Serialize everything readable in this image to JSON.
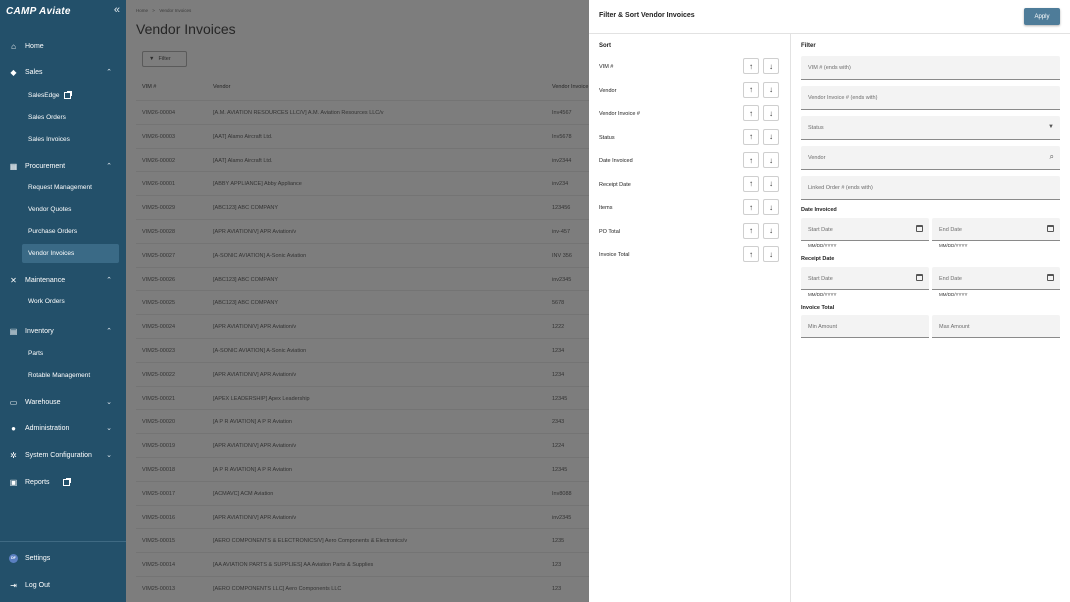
{
  "sidebar": {
    "logo": "CAMP Aviate",
    "collapse_icon": "double-chevron-left",
    "items": [
      {
        "label": "Home",
        "icon": "home-icon"
      },
      {
        "label": "Sales",
        "icon": "tag-icon",
        "expanded": true
      },
      {
        "label": "SalesEdge",
        "sub": true,
        "external": true
      },
      {
        "label": "Sales Orders",
        "sub": true
      },
      {
        "label": "Sales Invoices",
        "sub": true
      },
      {
        "label": "Procurement",
        "icon": "cart-icon",
        "expanded": true
      },
      {
        "label": "Request Management",
        "sub": true
      },
      {
        "label": "Vendor Quotes",
        "sub": true
      },
      {
        "label": "Purchase Orders",
        "sub": true
      },
      {
        "label": "Vendor Invoices",
        "sub": true,
        "active": true
      },
      {
        "label": "Maintenance",
        "icon": "wrench-icon",
        "expanded": true
      },
      {
        "label": "Work Orders",
        "sub": true
      },
      {
        "label": "Inventory",
        "icon": "inventory-icon",
        "expanded": true
      },
      {
        "label": "Parts",
        "sub": true
      },
      {
        "label": "Rotable Management",
        "sub": true
      },
      {
        "label": "Warehouse",
        "icon": "warehouse-icon"
      },
      {
        "label": "Administration",
        "icon": "people-icon"
      },
      {
        "label": "System Configuration",
        "icon": "gear-icon"
      },
      {
        "label": "Reports",
        "icon": "report-icon",
        "external": true
      }
    ],
    "settings_label": "Settings",
    "avatar_initials": "DF",
    "logout_label": "Log Out"
  },
  "main": {
    "breadcrumb": [
      "Home",
      ">",
      "Vendor Invoices"
    ],
    "title": "Vendor Invoices",
    "filter_label": "Filter",
    "columns": [
      "VIM #",
      "Vendor",
      "Vendor Invoice"
    ],
    "rows": [
      [
        "VIM26-00004",
        "[A.M. AVIATION RESOURCES LLC/V] A.M. Aviation Resources LLC/v",
        "Inv4567"
      ],
      [
        "VIM26-00003",
        "[AAT] Alamo Aircraft Ltd.",
        "Inv5678"
      ],
      [
        "VIM26-00002",
        "[AAT] Alamo Aircraft Ltd.",
        "inv2344"
      ],
      [
        "VIM26-00001",
        "[ABBY APPLIANCE] Abby Appliance",
        "inv234"
      ],
      [
        "VIM25-00029",
        "[ABC123] ABC COMPANY",
        "123456"
      ],
      [
        "VIM25-00028",
        "[APR AVIATION/V] APR Aviation/v",
        "inv-457"
      ],
      [
        "VIM25-00027",
        "[A-SONIC AVIATION] A-Sonic Aviation",
        "INV 356"
      ],
      [
        "VIM25-00026",
        "[ABC123] ABC COMPANY",
        "inv2345"
      ],
      [
        "VIM25-00025",
        "[ABC123] ABC COMPANY",
        "5678"
      ],
      [
        "VIM25-00024",
        "[APR AVIATION/V] APR Aviation/v",
        "1222"
      ],
      [
        "VIM25-00023",
        "[A-SONIC AVIATION] A-Sonic Aviation",
        "1234"
      ],
      [
        "VIM25-00022",
        "[APR AVIATION/V] APR Aviation/v",
        "1234"
      ],
      [
        "VIM25-00021",
        "[APEX LEADERSHIP] Apex Leadership",
        "12345"
      ],
      [
        "VIM25-00020",
        "[A P R AVIATION] A P R Aviation",
        "2343"
      ],
      [
        "VIM25-00019",
        "[APR AVIATION/V] APR Aviation/v",
        "1224"
      ],
      [
        "VIM25-00018",
        "[A P R AVIATION] A P R Aviation",
        "12345"
      ],
      [
        "VIM25-00017",
        "[ACMAVC] ACM Aviation",
        "Inv8088"
      ],
      [
        "VIM25-00016",
        "[APR AVIATION/V] APR Aviation/v",
        "inv2345"
      ],
      [
        "VIM25-00015",
        "[AERO COMPONENTS & ELECTRONICS/V] Aero Components & Electronics/v",
        "1235"
      ],
      [
        "VIM25-00014",
        "[AA AVIATION PARTS & SUPPLIES] AA Aviation Parts & Supplies",
        "123"
      ],
      [
        "VIM25-00013",
        "[AERO COMPONENTS LLC] Aero Components LLC",
        "123"
      ]
    ]
  },
  "panel": {
    "title": "Filter & Sort Vendor Invoices",
    "apply_label": "Apply",
    "sort_title": "Sort",
    "sort_fields": [
      "VIM #",
      "Vendor",
      "Vendor Invoice #",
      "Status",
      "Date Invoiced",
      "Receipt Date",
      "Items",
      "PO Total",
      "Invoice Total"
    ],
    "filter_title": "Filter",
    "filters": {
      "vim_placeholder": "VIM # (ends with)",
      "vendor_invoice_placeholder": "Vendor Invoice # (ends with)",
      "status_placeholder": "Status",
      "vendor_placeholder": "Vendor",
      "linked_order_placeholder": "Linked Order # (ends with)",
      "date_invoiced_label": "Date Invoiced",
      "receipt_date_label": "Receipt Date",
      "invoice_total_label": "Invoice Total",
      "start_date_placeholder": "Start Date",
      "end_date_placeholder": "End Date",
      "date_format_hint": "MM/DD/YYYY",
      "min_amount_placeholder": "Min Amount",
      "max_amount_placeholder": "Max Amount"
    }
  },
  "colors": {
    "sidebar_bg": "#23506a",
    "sidebar_active": "#3a6a86",
    "apply_button": "#4e7c99",
    "overlay": "#7d7d7d"
  }
}
